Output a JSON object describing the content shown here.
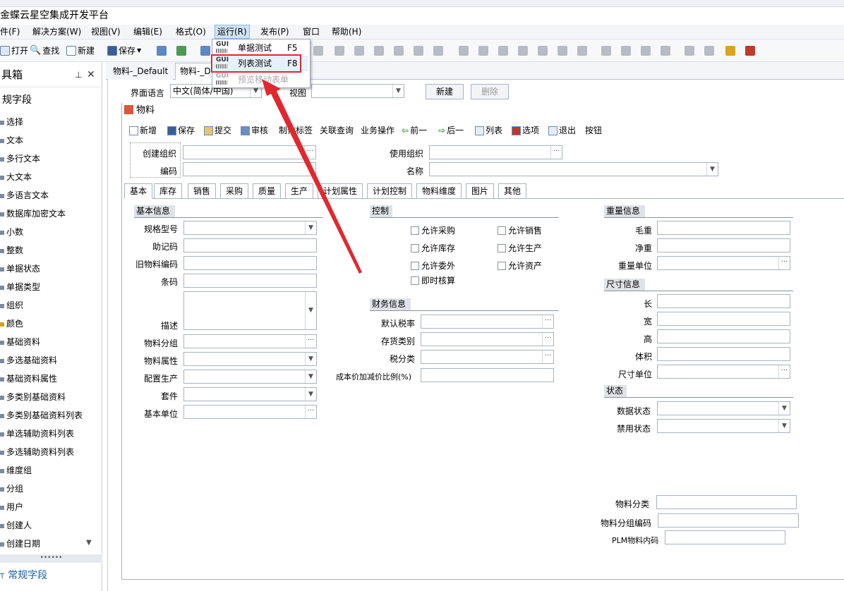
{
  "title": "金蝶云星空集成开发平台",
  "menu": [
    "件(F)",
    "解决方案(W)",
    "视图(V)",
    "编辑(E)",
    "格式(O)",
    "运行(R)",
    "发布(P)",
    "窗口",
    "帮助(H)"
  ],
  "toolbar": {
    "open": "打开",
    "find": "查找",
    "new": "新建",
    "save": "保存"
  },
  "run_menu": {
    "items": [
      {
        "label": "单据测试",
        "key": "F5",
        "icon": "GUI"
      },
      {
        "label": "列表测试",
        "key": "F8",
        "icon": "GUI"
      },
      {
        "label": "预览移动表单",
        "key": "",
        "icon": "GUI"
      }
    ]
  },
  "toolbox": {
    "title": "具箱",
    "section": "规字段",
    "items": [
      "选择",
      "文本",
      "多行文本",
      "大文本",
      "多语言文本",
      "数据库加密文本",
      "小数",
      "整数",
      "单据状态",
      "单据类型",
      "组织",
      "颜色",
      "基础资料",
      "多选基础资料",
      "基础资料属性",
      "多类别基础资料",
      "多类别基础资料列表",
      "单选辅助资料列表",
      "多选辅助资料列表",
      "维度组",
      "分组",
      "用户",
      "创建人",
      "创建日期"
    ],
    "scroll_dots": "••••••",
    "footer": "常规字段",
    "footer_icon": "T"
  },
  "doc_tabs": [
    "物料-_Default",
    "物料-_D"
  ],
  "lang_row": {
    "lang_label": "界面语言",
    "lang_value": "中文(简体/中国)",
    "view_label": "视图",
    "new_btn": "新建",
    "delete_btn": "删除"
  },
  "form": {
    "title": "物料",
    "toolbar": [
      "新增",
      "保存",
      "提交",
      "审核",
      "制作标签",
      "关联查询",
      "业务操作",
      "前一",
      "后一",
      "列表",
      "选项",
      "退出",
      "按钮"
    ],
    "header": {
      "create_org": "创建组织",
      "code": "编码",
      "use_org": "使用组织",
      "name": "名称"
    },
    "tabs": [
      "基本",
      "库存",
      "销售",
      "采购",
      "质量",
      "生产",
      "计划属性",
      "计划控制",
      "物料维度",
      "图片",
      "其他"
    ],
    "basic": {
      "title": "基本信息",
      "fields": [
        "规格型号",
        "助记码",
        "旧物料编码",
        "条码",
        "描述",
        "物料分组",
        "物料属性",
        "配置生产",
        "套件",
        "基本单位"
      ]
    },
    "control": {
      "title": "控制",
      "checks": [
        "允许采购",
        "允许销售",
        "允许库存",
        "允许生产",
        "允许委外",
        "允许资产",
        "即时核算"
      ]
    },
    "finance": {
      "title": "财务信息",
      "fields": [
        "默认税率",
        "存货类别",
        "税分类",
        "成本价加减价比例(%)"
      ]
    },
    "weight": {
      "title": "重量信息",
      "fields": [
        "毛重",
        "净重",
        "重量单位"
      ]
    },
    "size": {
      "title": "尺寸信息",
      "fields": [
        "长",
        "宽",
        "高",
        "体积",
        "尺寸单位"
      ]
    },
    "status": {
      "title": "状态",
      "fields": [
        "数据状态",
        "禁用状态"
      ]
    },
    "extra": [
      "物料分类",
      "物料分组编码",
      "PLM物料内码"
    ]
  },
  "colors": {
    "highlight": "#e0282e",
    "accent": "#1a5fa8"
  }
}
